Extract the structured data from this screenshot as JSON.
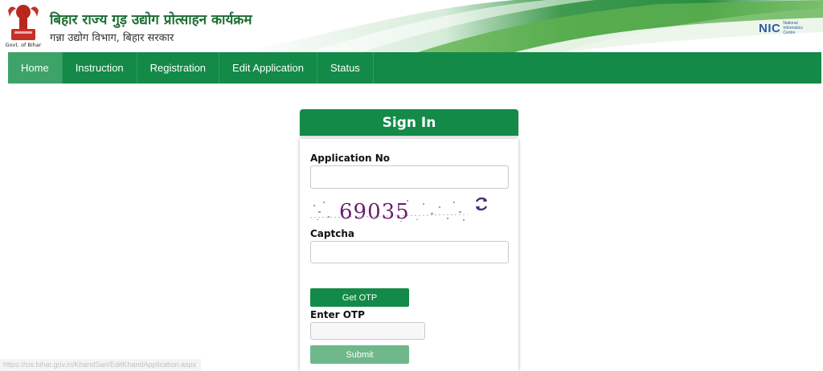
{
  "header": {
    "title": "बिहार राज्य गुड़ उद्योग प्रोत्साहन कार्यक्रम",
    "subtitle": "गन्ना उद्योग विभाग, बिहार सरकार",
    "emblem_caption": "Govt. of Bihar",
    "nic_logo_text": "NIC",
    "nic_logo_sub": "National Informatics Centre"
  },
  "nav": {
    "items": [
      {
        "label": "Home",
        "active": true
      },
      {
        "label": "Instruction"
      },
      {
        "label": "Registration"
      },
      {
        "label": "Edit Application"
      },
      {
        "label": "Status"
      }
    ]
  },
  "signin": {
    "title": "Sign In",
    "application_no_label": "Application No",
    "application_no_value": "",
    "captcha_value": "69035",
    "captcha_label": "Captcha",
    "captcha_input_value": "",
    "get_otp_label": "Get OTP",
    "enter_otp_label": "Enter OTP",
    "otp_value": "",
    "submit_label": "Submit"
  },
  "statusbar": {
    "url": "https://cis.bihar.gov.in/KhandSari/EditKhandApplication.aspx"
  },
  "colors": {
    "primary_green": "#138a48",
    "active_nav": "#3da369",
    "disabled_submit": "#6fb88c",
    "captcha_text": "#6a1f70",
    "nic_blue": "#2c5aa0"
  }
}
